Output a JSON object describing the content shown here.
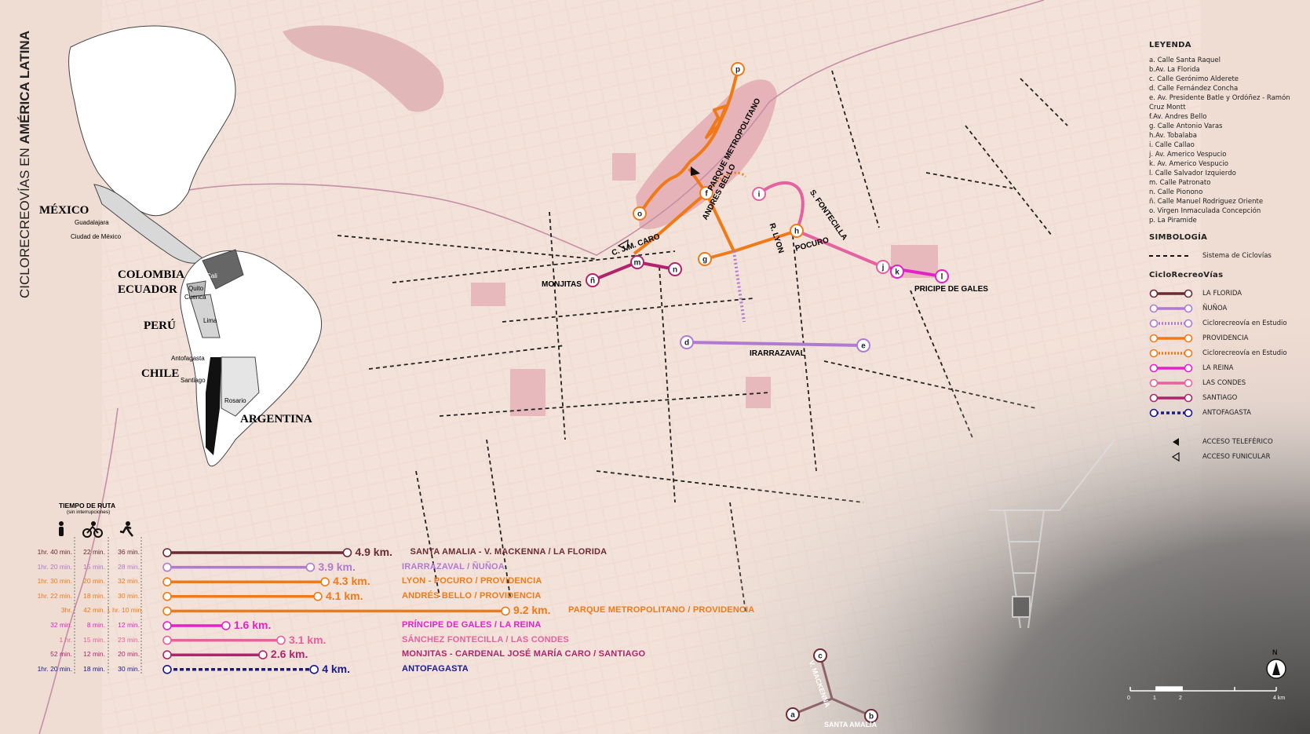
{
  "vertical_title": {
    "part1": "CICLORECREOVÍAS EN ",
    "part2": "AMÉRICA LATINA"
  },
  "countries": {
    "mexico": "MÉXICO",
    "colombia": "COLOMBIA",
    "ecuador": "ECUADOR",
    "peru": "PERÚ",
    "chile": "CHILE",
    "argentina": "ARGENTINA"
  },
  "cities": {
    "guadalajara": "Guadalajara",
    "cdmx": "Ciudad de México",
    "cali": "Cali",
    "quito": "Quito",
    "cuenca": "Cuenca",
    "lima": "Lima",
    "antofagasta": "Antofagasta",
    "santiago": "Santiago",
    "rosario": "Rosario"
  },
  "legend": {
    "title": "LEYENDA",
    "items": [
      "a. Calle Santa Raquel",
      "b.Av. La Florida",
      "c. Calle Gerónimo Alderete",
      "d. Calle Fernández Concha",
      "e. Av. Presidente Batle y Ordóñez - Ramón Cruz Montt",
      "f.Av. Andres Bello",
      "g. Calle Antonio Varas",
      "h.Av. Tobalaba",
      "i. Calle Callao",
      "j. Av. Americo Vespucio",
      "k. Av. Americo Vespucio",
      "l. Calle Salvador Izquierdo",
      "m. Calle Patronato",
      "n. Calle Pionono",
      "ñ. Calle Manuel Rodriguez Oriente",
      "o. Virgen Inmaculada Concepción",
      "p. La Piramide"
    ],
    "simbologia_title": "SIMBOLOGÍA",
    "sistema": "Sistema de Ciclovías",
    "ciclo_title": "CicloRecreoVías",
    "routes": [
      {
        "label": "LA FLORIDA",
        "color": "#6b2a35",
        "style": "solid"
      },
      {
        "label": "ÑUÑOA",
        "color": "#b07ad0",
        "style": "solid"
      },
      {
        "label": "Ciclorecreovía en Estudio",
        "color": "#b07ad0",
        "style": "dotted"
      },
      {
        "label": "PROVIDENCIA",
        "color": "#f07a18",
        "style": "solid"
      },
      {
        "label": "Ciclorecreovía en Estudio",
        "color": "#f07a18",
        "style": "dotted"
      },
      {
        "label": "LA REINA",
        "color": "#e024c8",
        "style": "solid"
      },
      {
        "label": "LAS CONDES",
        "color": "#e462a0",
        "style": "solid"
      },
      {
        "label": "SANTIAGO",
        "color": "#b0246e",
        "style": "solid"
      },
      {
        "label": "ANTOFAGASTA",
        "color": "#1a1a8c",
        "style": "dashed"
      }
    ],
    "teleferico": "ACCESO TELEFÉRICO",
    "funicular": "ACCESO FUNICULAR"
  },
  "street_labels": {
    "monjitas": "MONJITAS",
    "cjm_caro": "C. J.M. CARO",
    "andres_bello": "ANDRES BELLO",
    "parque": "PARQUE METROPOLITANO",
    "rlyon": "R. LYON",
    "pocuro": "POCURO",
    "sfontecilla": "S. FONTECILLA",
    "pricipe": "PRICIPE DE GALES",
    "irarrazaval": "IRARRAZAVAL",
    "vmackenna": "V. MACKENNA",
    "santa_amalia": "SANTA AMALIA"
  },
  "nodes": [
    "a",
    "b",
    "c",
    "d",
    "e",
    "f",
    "g",
    "h",
    "i",
    "j",
    "k",
    "l",
    "m",
    "n",
    "ñ",
    "o",
    "p"
  ],
  "tiempo": {
    "title": "TIEMPO DE RUTA",
    "subtitle": "(sin interrupciones)",
    "icons": [
      "walk-icon",
      "bike-icon",
      "run-icon"
    ],
    "rows": [
      {
        "walk": "1hr. 40 min.",
        "bike": "22 min.",
        "run": "36 min.",
        "km": "4.9 km.",
        "label": "SANTA AMALIA - V. MACKENNA / LA FLORIDA",
        "color": "#6b2a35",
        "frac": 0.478,
        "style": "solid"
      },
      {
        "walk": "1hr. 20 min.",
        "bike": "15 min.",
        "run": "28 min.",
        "km": "3.9 km.",
        "label": "IRARRAZAVAL / ÑUÑOA",
        "color": "#b07ad0",
        "frac": 0.38,
        "style": "solid"
      },
      {
        "walk": "1hr. 30 min.",
        "bike": "20 min.",
        "run": "32 min.",
        "km": "4.3 km.",
        "label": "LYON - POCURO / PROVIDENCIA",
        "color": "#f07a18",
        "frac": 0.419,
        "style": "solid"
      },
      {
        "walk": "1hr. 22 min.",
        "bike": "18 min.",
        "run": "30 min.",
        "km": "4.1 km.",
        "label": "ANDRÉS BELLO / PROVIDENCIA",
        "color": "#f07a18",
        "frac": 0.4,
        "style": "solid"
      },
      {
        "walk": "3hr.",
        "bike": "42 min.",
        "run": "1 hr. 10 min.",
        "km": "9.2 km.",
        "label": "PARQUE METROPOLITANO / PROVIDENCIA",
        "color": "#f07a18",
        "frac": 0.898,
        "style": "solid"
      },
      {
        "walk": "32 min.",
        "bike": "8 min.",
        "run": "12 min.",
        "km": "1.6 km.",
        "label": "PRÍNCIPE DE GALES / LA REINA",
        "color": "#e024c8",
        "frac": 0.156,
        "style": "solid"
      },
      {
        "walk": "1 hr.",
        "bike": "15 min.",
        "run": "23 min.",
        "km": "3.1 km.",
        "label": "SÁNCHEZ FONTECILLA / LAS CONDES",
        "color": "#e462a0",
        "frac": 0.302,
        "style": "solid"
      },
      {
        "walk": "52 min.",
        "bike": "12 min.",
        "run": "20 min.",
        "km": "2.6 km.",
        "label": "MONJITAS - CARDENAL JOSÉ MARÍA CARO / SANTIAGO",
        "color": "#b0246e",
        "frac": 0.254,
        "style": "solid"
      },
      {
        "walk": "1hr. 20 min.",
        "bike": "18 min.",
        "run": "30 min.",
        "km": "4 km.",
        "label": "ANTOFAGASTA",
        "color": "#1a1a8c",
        "frac": 0.39,
        "style": "dashed"
      }
    ]
  },
  "north": "N",
  "scale": {
    "labels": [
      "0",
      "1",
      "2",
      "4 km"
    ]
  }
}
